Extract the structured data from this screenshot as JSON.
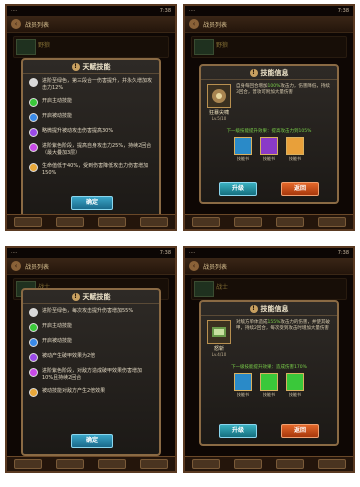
{
  "panels": [
    {
      "status_left": "····",
      "status_right": "7:38",
      "topbar_title": "战员列表",
      "bg_name": "野狼",
      "dialog_title": "天赋技能",
      "talents": [
        {
          "text": "进阶至绿色，第三段合一伤害提升，并永久增加攻击力12%",
          "color": "#d8d8d8"
        },
        {
          "text": "开启主动技能",
          "color": "#3ac83a"
        },
        {
          "text": "开启被动技能",
          "color": "#3a8ae8"
        },
        {
          "text": "略微提升被动攻击伤害提高30%",
          "color": "#9a4ae8"
        },
        {
          "text": "进阶紫色阶段，提高自身攻击力25%，持续2回合（最大叠加3层）",
          "color": "#c84ae8"
        },
        {
          "text": "生命值低于40%，受到伤害降低攻击力伤害增加150%",
          "color": "#e8a83a"
        }
      ],
      "confirm_label": "确定"
    },
    {
      "status_left": "····",
      "status_right": "7:38",
      "topbar_title": "战员列表",
      "bg_name": "野狼",
      "dialog_title": "技能信息",
      "skill_name": "狂暴尖啸",
      "skill_level": "Lv.5/10",
      "skill_desc_a": "自身每回合增加",
      "skill_desc_hl": "100%",
      "skill_desc_b": "攻击力，伤害降低，持续3回合，普攻可附加大量伤害",
      "next_level": "下一级技能提升效果：提高攻击力到105%",
      "materials": [
        {
          "label": "技能书",
          "color": "#2a8ac8"
        },
        {
          "label": "技能书",
          "color": "#8a3ac8"
        },
        {
          "label": "技能书",
          "color": "#e8a03a"
        }
      ],
      "upgrade_label": "升级",
      "back_label": "返回"
    },
    {
      "status_left": "····",
      "status_right": "7:38",
      "topbar_title": "战员列表",
      "bg_name": "战士",
      "dialog_title": "天赋技能",
      "talents": [
        {
          "text": "进阶至绿色，每次攻击提升伤害增加55%",
          "color": "#d8d8d8"
        },
        {
          "text": "开启主动技能",
          "color": "#3ac83a"
        },
        {
          "text": "开启被动技能",
          "color": "#3a8ae8"
        },
        {
          "text": "被动产生破甲效果为2倍",
          "color": "#9a4ae8"
        },
        {
          "text": "进阶紫色阶段，对敌方造成破甲效果伤害增加10%且持续2回合",
          "color": "#c84ae8"
        },
        {
          "text": "被动技能对敌方产生2倍效果",
          "color": "#e8a83a"
        }
      ],
      "confirm_label": "确定"
    },
    {
      "status_left": "····",
      "status_right": "7:38",
      "topbar_title": "战员列表",
      "bg_name": "战士",
      "dialog_title": "技能信息",
      "skill_name": "怒斩",
      "skill_level": "Lv.4/10",
      "skill_desc_a": "对敌方单体造成",
      "skill_desc_hl": "155%",
      "skill_desc_b": "攻击力的伤害，并使其破甲，持续2回合，每次受到攻击时增加大量伤害",
      "next_level": "下一级技能提升效果：造成伤害170%",
      "materials": [
        {
          "label": "技能书",
          "color": "#2a8ac8"
        },
        {
          "label": "技能书",
          "color": "#3ac83a"
        },
        {
          "label": "技能书",
          "color": "#3ac83a"
        }
      ],
      "upgrade_label": "升级",
      "back_label": "返回"
    }
  ]
}
